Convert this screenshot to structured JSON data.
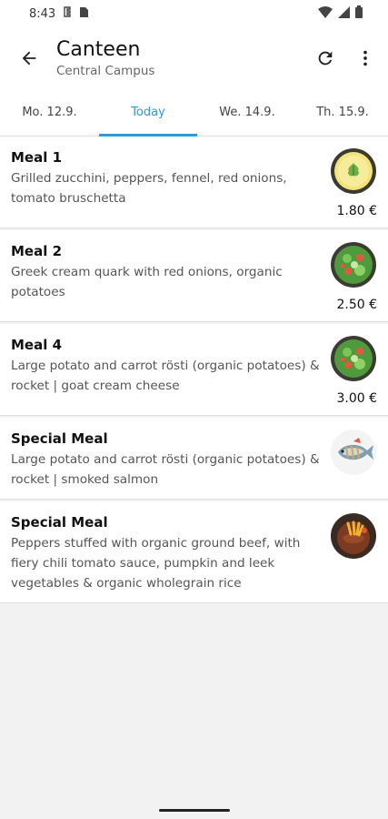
{
  "status": {
    "time": "8:43"
  },
  "app_bar": {
    "title": "Canteen",
    "subtitle": "Central Campus"
  },
  "tabs": [
    {
      "label": "Mo. 12.9.",
      "active": false
    },
    {
      "label": "Today",
      "active": true
    },
    {
      "label": "We. 14.9.",
      "active": false
    },
    {
      "label": "Th. 15.9.",
      "active": false
    }
  ],
  "colors": {
    "accent": "#2f9bd0",
    "background": "#f2f2f2",
    "card": "#ffffff"
  },
  "meals": [
    {
      "name": "Meal 1",
      "description": "Grilled zucchini, peppers, fennel, red onions, tomato bruschetta",
      "price": "1.80 €",
      "icon": "vegetarian-plate-icon"
    },
    {
      "name": "Meal 2",
      "description": "Greek cream quark with red onions, organic potatoes",
      "price": "2.50 €",
      "icon": "vegan-salad-icon"
    },
    {
      "name": "Meal 4",
      "description": "Large potato and carrot rösti (organic potatoes) & rocket | goat cream cheese",
      "price": "3.00 €",
      "icon": "vegan-salad-icon"
    },
    {
      "name": "Special Meal",
      "description": "Large potato and carrot rösti (organic potatoes) & rocket | smoked salmon",
      "price": "",
      "icon": "fish-icon"
    },
    {
      "name": "Special Meal",
      "description": "Peppers stuffed with organic ground beef, with fiery chili tomato sauce, pumpkin and leek vegetables & organic wholegrain rice",
      "price": "",
      "icon": "meat-dish-icon"
    }
  ]
}
